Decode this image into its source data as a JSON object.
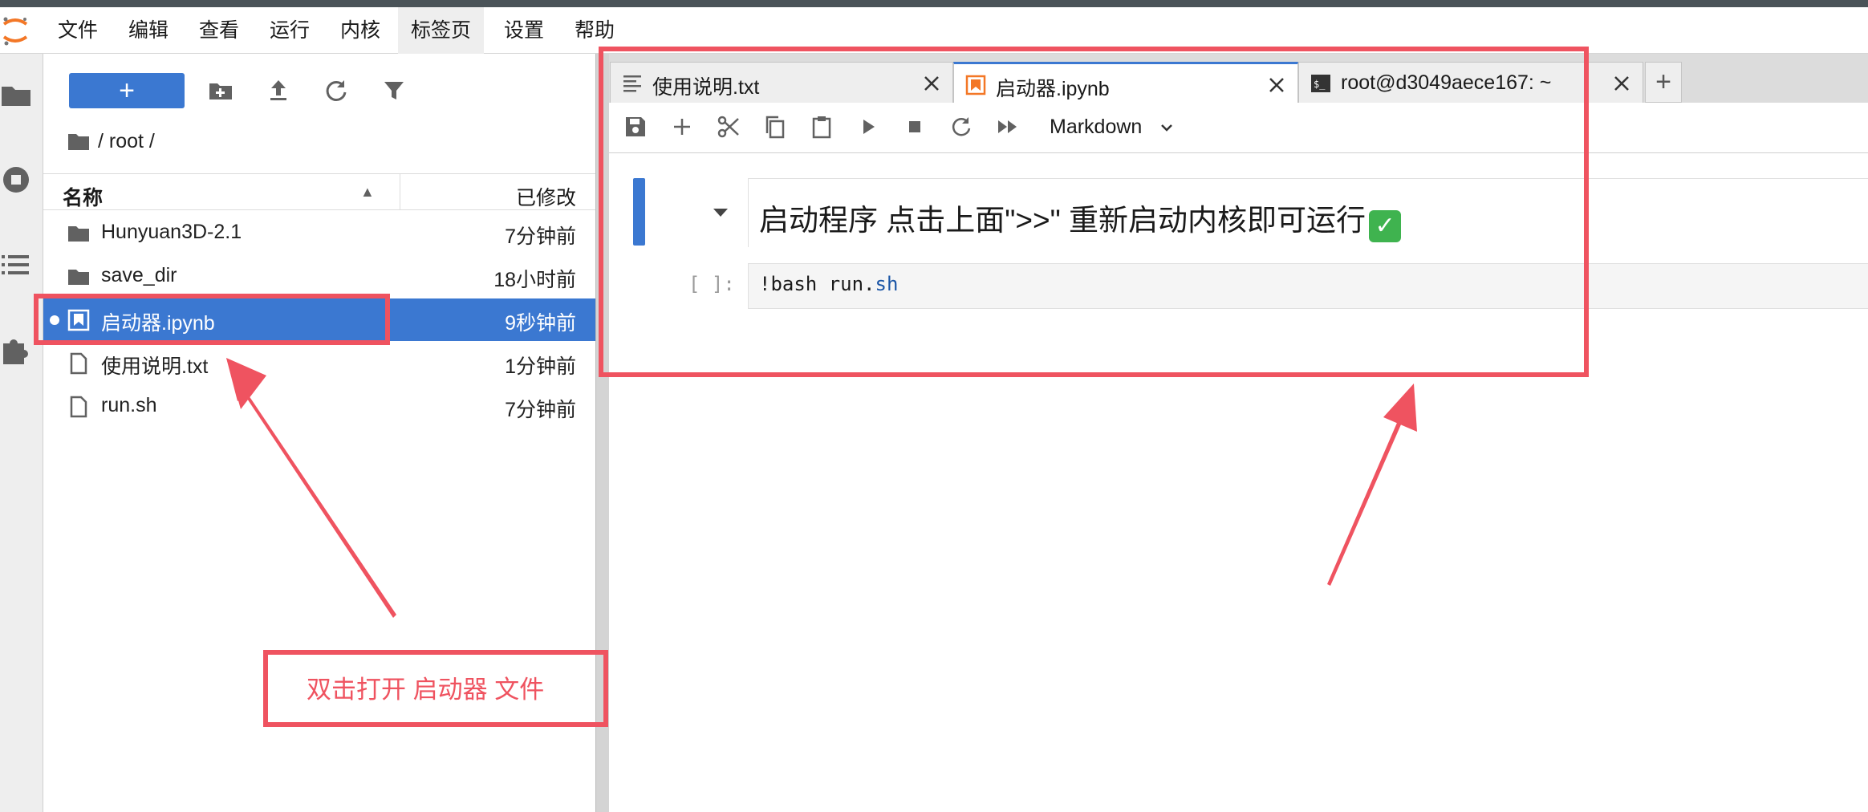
{
  "menubar": {
    "items": [
      {
        "label": "文件"
      },
      {
        "label": "编辑"
      },
      {
        "label": "查看"
      },
      {
        "label": "运行"
      },
      {
        "label": "内核"
      },
      {
        "label": "标签页"
      },
      {
        "label": "设置"
      },
      {
        "label": "帮助"
      }
    ],
    "active_index": 5
  },
  "file_browser": {
    "new_button_label": "+",
    "breadcrumb": "/ root /",
    "columns": {
      "name": "名称",
      "modified": "已修改"
    },
    "sort_indicator": "▲",
    "files": [
      {
        "icon": "folder-icon",
        "name": "Hunyuan3D-2.1",
        "modified": "7分钟前",
        "selected": false
      },
      {
        "icon": "folder-icon",
        "name": "save_dir",
        "modified": "18小时前",
        "selected": false
      },
      {
        "icon": "notebook-icon",
        "name": "启动器.ipynb",
        "modified": "9秒钟前",
        "selected": true,
        "running": true
      },
      {
        "icon": "file-icon",
        "name": "使用说明.txt",
        "modified": "1分钟前",
        "selected": false
      },
      {
        "icon": "file-icon",
        "name": "run.sh",
        "modified": "7分钟前",
        "selected": false
      }
    ]
  },
  "tabs": [
    {
      "icon": "text-file-icon",
      "label": "使用说明.txt",
      "active": false
    },
    {
      "icon": "notebook-icon",
      "label": "启动器.ipynb",
      "active": true
    },
    {
      "icon": "terminal-icon",
      "label": "root@d3049aece167: ~",
      "active": false
    }
  ],
  "tab_add_label": "+",
  "notebook": {
    "cell_type": "Markdown",
    "markdown_heading": "启动程序 点击上面\">>\" 重新启动内核即可运行",
    "heading_emoji": "✓",
    "code_prompt": "[ ]:",
    "code_text": "!bash run.",
    "code_text_ext": "sh"
  },
  "annotation": {
    "text": "双击打开 启动器 文件"
  },
  "colors": {
    "accent": "#3b78d1",
    "annotation_red": "#ef5360",
    "notebook_orange": "#f37726"
  }
}
